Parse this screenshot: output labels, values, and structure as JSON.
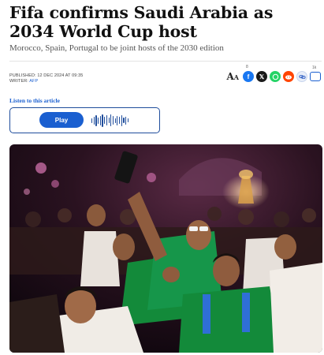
{
  "article": {
    "headline": "Fifa confirms Saudi Arabia as 2034 World Cup host",
    "subheadline": "Morocco, Spain, Portugal to be joint hosts of the 2030 edition",
    "published_label": "PUBLISHED",
    "published_value": ": 12 DEC 2024 AT 09:35",
    "writer_label": "WRITER:",
    "writer_value": "AFP"
  },
  "share": {
    "text_size_label": "A",
    "facebook_count": "8",
    "comment_count": "1k",
    "icons": [
      "text-size-icon",
      "facebook-icon",
      "x-icon",
      "whatsapp-icon",
      "reddit-icon",
      "copy-link-icon",
      "comment-icon"
    ]
  },
  "audio": {
    "listen_label": "Listen to this article",
    "play_label": "Play"
  },
  "colors": {
    "accent": "#1a5fd0",
    "player_border": "#1f4d9c",
    "jersey_green": "#138a3a"
  }
}
